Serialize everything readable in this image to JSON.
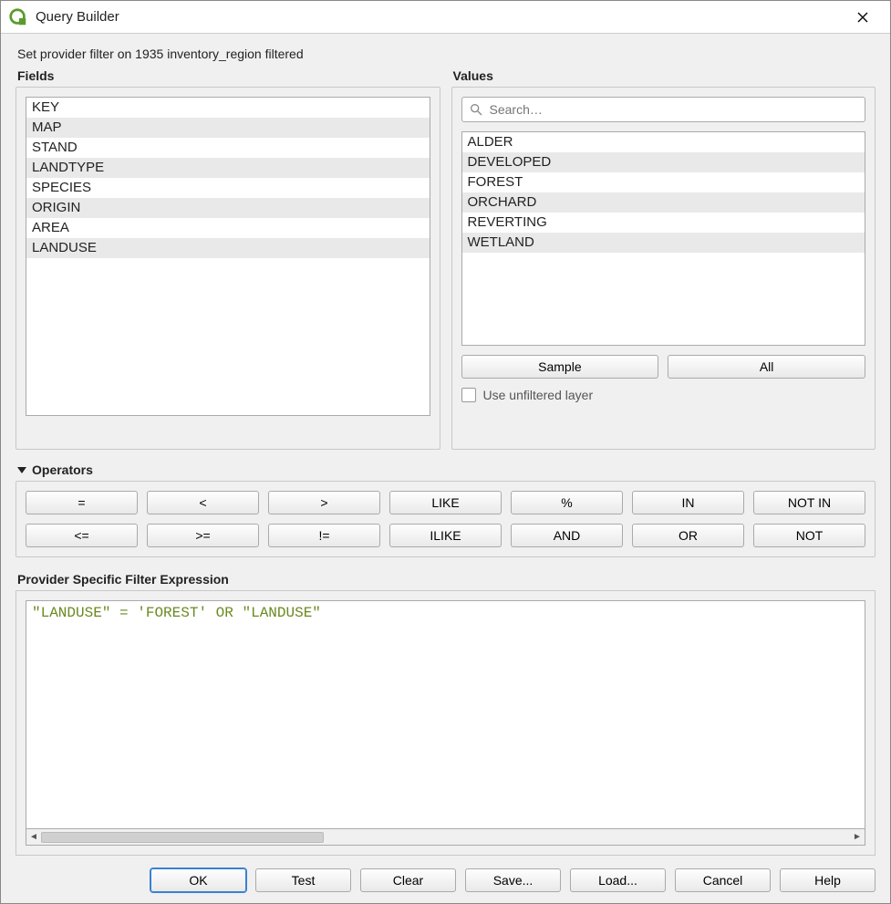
{
  "window": {
    "title": "Query Builder",
    "hint": "Set provider filter on 1935 inventory_region filtered"
  },
  "fields": {
    "label": "Fields",
    "items": [
      "KEY",
      "MAP",
      "STAND",
      "LANDTYPE",
      "SPECIES",
      "ORIGIN",
      "AREA",
      "LANDUSE"
    ]
  },
  "values": {
    "label": "Values",
    "search_placeholder": "Search…",
    "items": [
      "ALDER",
      "DEVELOPED",
      "FOREST",
      "ORCHARD",
      "REVERTING",
      "WETLAND"
    ],
    "sample_label": "Sample",
    "all_label": "All",
    "unfiltered_label": "Use unfiltered layer"
  },
  "operators": {
    "label": "Operators",
    "buttons": [
      "=",
      "<",
      ">",
      "LIKE",
      "%",
      "IN",
      "NOT IN",
      "<=",
      ">=",
      "!=",
      "ILIKE",
      "AND",
      "OR",
      "NOT"
    ]
  },
  "expression": {
    "label": "Provider Specific Filter Expression",
    "tokens": [
      {
        "t": "field",
        "v": "\"LANDUSE\""
      },
      {
        "t": "plain",
        "v": " "
      },
      {
        "t": "op",
        "v": "="
      },
      {
        "t": "plain",
        "v": " "
      },
      {
        "t": "str",
        "v": "'FOREST'"
      },
      {
        "t": "plain",
        "v": " "
      },
      {
        "t": "kw",
        "v": "OR"
      },
      {
        "t": "plain",
        "v": " "
      },
      {
        "t": "field",
        "v": "\"LANDUSE\""
      }
    ]
  },
  "buttons": {
    "ok": "OK",
    "test": "Test",
    "clear": "Clear",
    "save": "Save...",
    "load": "Load...",
    "cancel": "Cancel",
    "help": "Help"
  }
}
